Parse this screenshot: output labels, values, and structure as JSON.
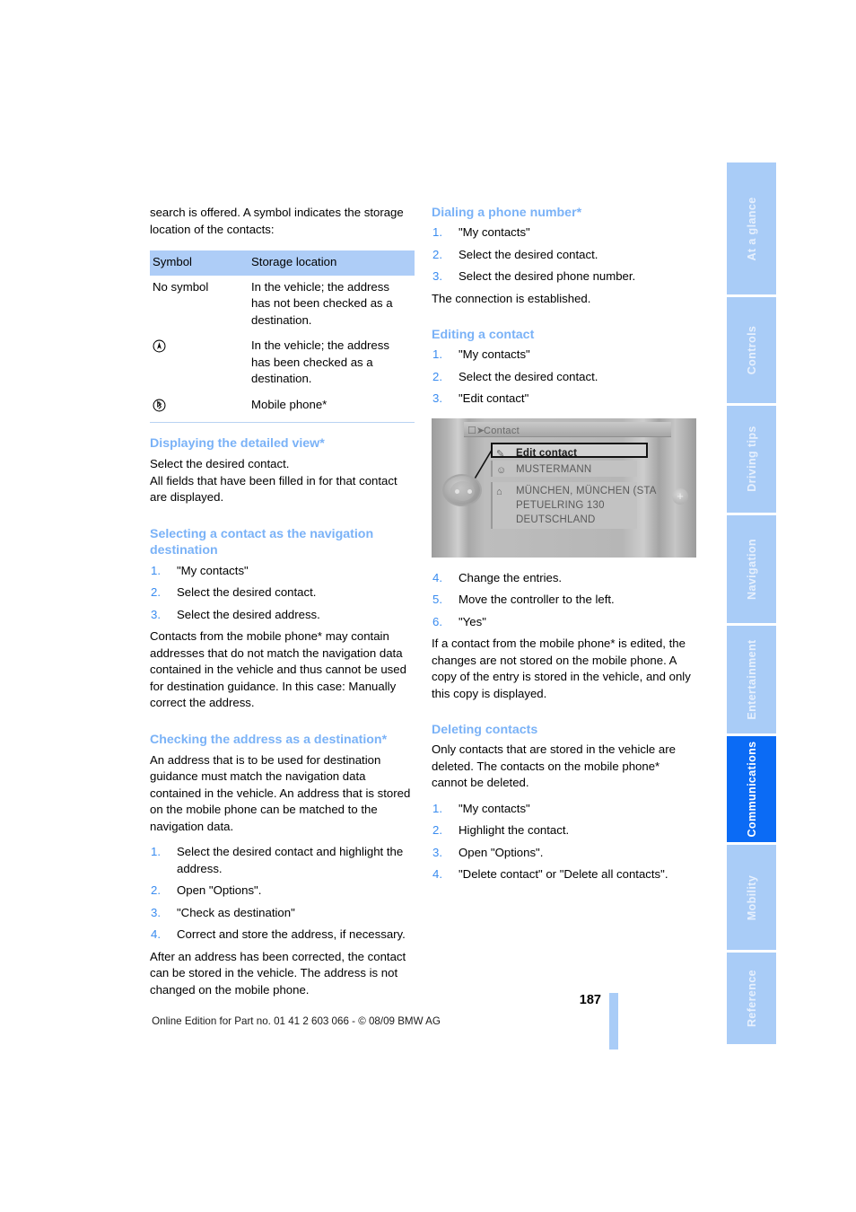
{
  "page": {
    "number": "187",
    "footer_note": "Online Edition for Part no. 01 41 2 603 066 - © 08/09 BMW AG"
  },
  "tabs": [
    {
      "label": "At a glance",
      "active": false
    },
    {
      "label": "Controls",
      "active": false
    },
    {
      "label": "Driving tips",
      "active": false
    },
    {
      "label": "Navigation",
      "active": false
    },
    {
      "label": "Entertainment",
      "active": false
    },
    {
      "label": "Communications",
      "active": true
    },
    {
      "label": "Mobility",
      "active": false
    },
    {
      "label": "Reference",
      "active": false
    }
  ],
  "left": {
    "intro": "search is offered. A symbol indicates the storage location of the contacts:",
    "table": {
      "headers": [
        "Symbol",
        "Storage location"
      ],
      "rows": [
        {
          "symbol": "No symbol",
          "symbol_icon": "",
          "location": "In the vehicle; the address has not been checked as a destination."
        },
        {
          "symbol": "",
          "symbol_icon": "navigation-arrow-circle-icon",
          "location": "In the vehicle; the address has been checked as a destination."
        },
        {
          "symbol": "",
          "symbol_icon": "bluetooth-circle-icon",
          "location": "Mobile phone*"
        }
      ]
    },
    "detailed_view": {
      "heading": "Displaying the detailed view*",
      "body": "Select the desired contact.\nAll fields that have been filled in for that contact are displayed."
    },
    "nav_destination": {
      "heading": "Selecting a contact as the navigation destination",
      "steps": [
        "\"My contacts\"",
        "Select the desired contact.",
        "Select the desired address."
      ],
      "note": "Contacts from the mobile phone* may contain addresses that do not match the navigation data contained in the vehicle and thus cannot be used for destination guidance. In this case: Manually correct the address."
    },
    "checking_address": {
      "heading": "Checking the address as a destination*",
      "intro": "An address that is to be used for destination guidance must match the navigation data contained in the vehicle. An address that is stored on the mobile phone can be matched to the navigation data.",
      "steps": [
        "Select the desired contact and highlight the address.",
        "Open \"Options\".",
        "\"Check as destination\"",
        "Correct and store the address, if necessary."
      ],
      "note": "After an address has been corrected, the contact can be stored in the vehicle. The address is not changed on the mobile phone."
    }
  },
  "right": {
    "dialing": {
      "heading": "Dialing a phone number*",
      "steps": [
        "\"My contacts\"",
        "Select the desired contact.",
        "Select the desired phone number."
      ],
      "note": "The connection is established."
    },
    "editing": {
      "heading": "Editing a contact",
      "steps_before": [
        "\"My contacts\"",
        "Select the desired contact.",
        "\"Edit contact\""
      ],
      "steps_after": [
        {
          "num": "4.",
          "text": "Change the entries."
        },
        {
          "num": "5.",
          "text": "Move the controller to the left."
        },
        {
          "num": "6.",
          "text": "\"Yes\""
        }
      ],
      "note": "If a contact from the mobile phone* is edited, the changes are not stored on the mobile phone. A copy of the entry is stored in the vehicle, and only this copy is displayed."
    },
    "idrive_screenshot": {
      "window_title": "Contact",
      "window_icon": "contact-card-icon",
      "selected_item": {
        "icon": "pencil-edit-icon",
        "label": "Edit contact"
      },
      "name_item": {
        "icon": "person-icon",
        "label": "MUSTERMANN"
      },
      "address_item": {
        "icon": "house-address-icon",
        "line1": "MÜNCHEN, MÜNCHEN (STA",
        "line2": "PETUELRING 130",
        "line3": "DEUTSCHLAND"
      },
      "controller_icon": "idrive-controller-icon",
      "plus_icon": "plus-icon"
    },
    "deleting": {
      "heading": "Deleting contacts",
      "intro": "Only contacts that are stored in the vehicle are deleted. The contacts on the mobile phone* cannot be deleted.",
      "steps": [
        "\"My contacts\"",
        "Highlight the contact.",
        "Open \"Options\".",
        "\"Delete contact\" or \"Delete all contacts\"."
      ]
    }
  },
  "colors": {
    "heading_blue": "#7ab2f7",
    "number_blue": "#3a8cf0",
    "tab_blue": "#a9ccf7",
    "tab_active_blue": "#0b6bf5",
    "table_header_blue": "#aecdf7"
  }
}
